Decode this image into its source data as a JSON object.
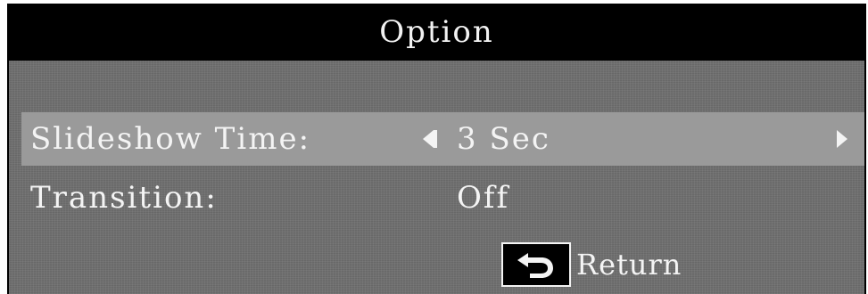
{
  "title": "Option",
  "menu": {
    "items": [
      {
        "label": "Slideshow Time:",
        "value": "3 Sec",
        "selected": true
      },
      {
        "label": "Transition:",
        "value": "Off",
        "selected": false
      }
    ]
  },
  "footer": {
    "return_label": "Return",
    "return_icon": "return-arrow-icon"
  },
  "colors": {
    "title_bar": "#000000",
    "panel": "#6f6f6f",
    "selected_row": "#9a9a9a",
    "text": "#f4f4f4"
  }
}
